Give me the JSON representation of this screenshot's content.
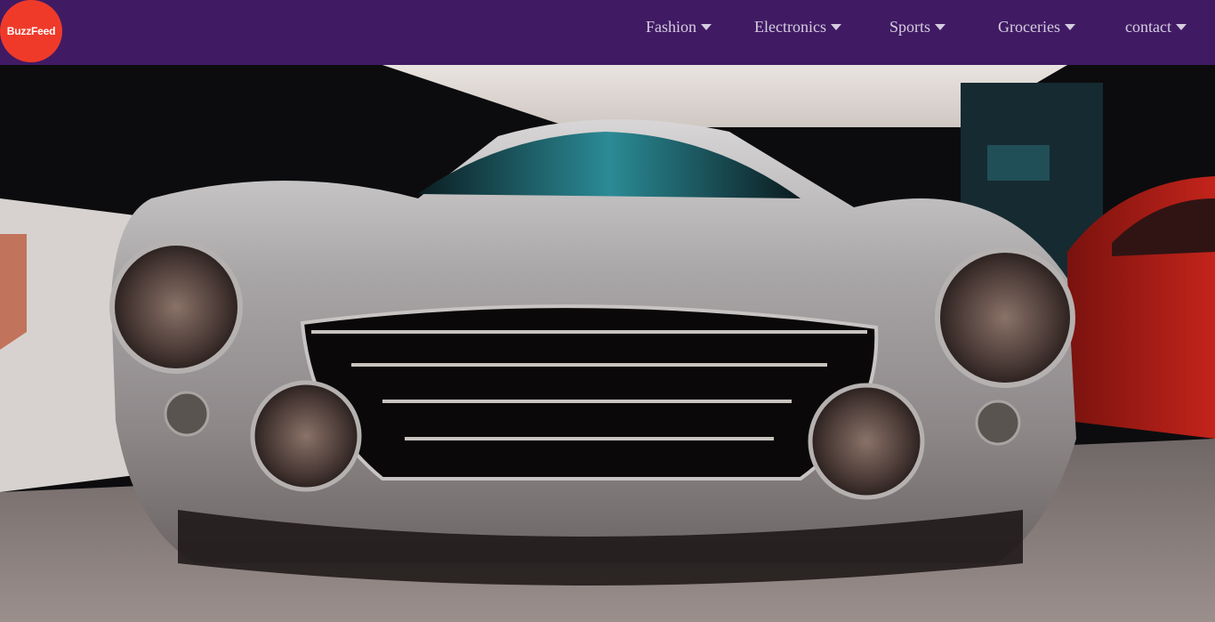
{
  "header": {
    "logo_text": "BuzzFeed",
    "brand_color": "#401b64",
    "logo_color": "#ef3a2a",
    "nav_items": [
      {
        "label": "Fashion",
        "icon": "caret-down-icon"
      },
      {
        "label": "Electronics",
        "icon": "caret-down-icon"
      },
      {
        "label": "Sports",
        "icon": "caret-down-icon"
      },
      {
        "label": "Groceries",
        "icon": "caret-down-icon"
      },
      {
        "label": "contact",
        "icon": "caret-down-icon"
      }
    ]
  },
  "hero": {
    "subject": "vintage-silver-sports-car-front"
  }
}
